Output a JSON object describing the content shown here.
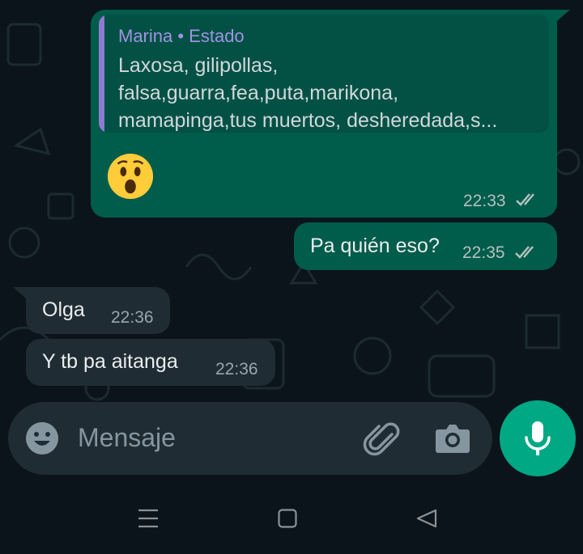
{
  "chat": {
    "messages": [
      {
        "direction": "outgoing",
        "quote": {
          "author": "Marina • Estado",
          "text": "Laxosa, gilipollas,\nfalsa,guarra,fea,puta,marikona,\nmamapinga,tus muertos, desheredada,s..."
        },
        "emoji": "surprised-face",
        "time": "22:33",
        "status": "read"
      },
      {
        "direction": "outgoing",
        "text": "Pa quién eso?",
        "time": "22:35",
        "status": "read"
      },
      {
        "direction": "incoming",
        "text": "Olga",
        "time": "22:36"
      },
      {
        "direction": "incoming",
        "text": "Y tb pa aitanga",
        "time": "22:36"
      }
    ]
  },
  "composer": {
    "placeholder": "Mensaje",
    "icons": [
      "emoji-icon",
      "attach-icon",
      "camera-icon",
      "mic-icon"
    ]
  },
  "colors": {
    "outgoing_bubble": "#005c4b",
    "incoming_bubble": "#202c33",
    "accent": "#00a884",
    "quote_author": "#a192e4"
  }
}
